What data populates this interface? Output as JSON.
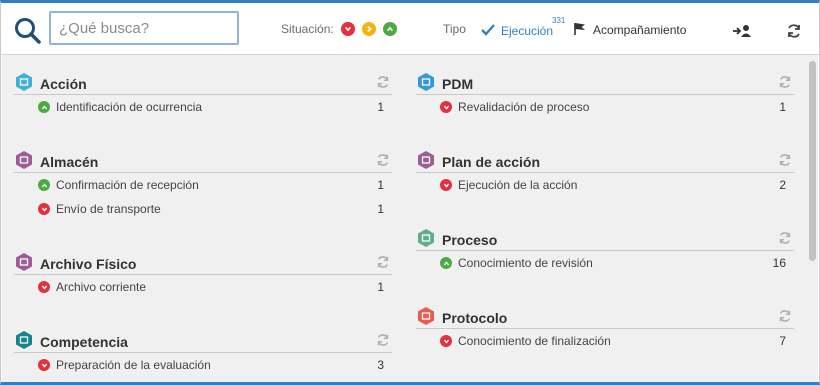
{
  "colors": {
    "accent": "#2f80c4",
    "red": "#e2323d",
    "yellow": "#f0b413",
    "green": "#4caa43",
    "gray_icon": "#9a9a9a"
  },
  "search": {
    "placeholder": "¿Qué busca?"
  },
  "toolbar": {
    "situacion_label": "Situación:",
    "tipo_label": "Tipo",
    "tabs": [
      {
        "label": "Ejecución",
        "count": "331",
        "icon": "check-icon",
        "active": true
      },
      {
        "label": "Acompañamiento",
        "icon": "flag-icon",
        "active": false
      }
    ]
  },
  "groups_left": [
    {
      "title": "Acción",
      "icon": "lightning-icon",
      "icon_color": "#3fb0d9",
      "items": [
        {
          "name": "Identificación de ocurrencia",
          "count": "1",
          "status": "green"
        }
      ]
    },
    {
      "title": "Almacén",
      "icon": "warehouse-icon",
      "icon_color": "#9b5d94",
      "items": [
        {
          "name": "Confirmación de recepción",
          "count": "1",
          "status": "green"
        },
        {
          "name": "Envío de transporte",
          "count": "1",
          "status": "red"
        }
      ]
    },
    {
      "title": "Archivo Físico",
      "icon": "archive-icon",
      "icon_color": "#9b5d94",
      "items": [
        {
          "name": "Archivo corriente",
          "count": "1",
          "status": "red"
        }
      ]
    },
    {
      "title": "Competencia",
      "icon": "competence-icon",
      "icon_color": "#14858a",
      "items": [
        {
          "name": "Preparación de la evaluación",
          "count": "3",
          "status": "red"
        }
      ]
    }
  ],
  "groups_right": [
    {
      "title": "PDM",
      "icon": "pdm-icon",
      "icon_color": "#3498d8",
      "items": [
        {
          "name": "Revalidación de proceso",
          "count": "1",
          "status": "red"
        }
      ]
    },
    {
      "title": "Plan de acción",
      "icon": "action-plan-icon",
      "icon_color": "#9b5d94",
      "items": [
        {
          "name": "Ejecución de la acción",
          "count": "2",
          "status": "red"
        }
      ]
    },
    {
      "title": "Proceso",
      "icon": "process-icon",
      "icon_color": "#5fae8b",
      "items": [
        {
          "name": "Conocimiento de revisión",
          "count": "16",
          "status": "green"
        }
      ]
    },
    {
      "title": "Protocolo",
      "icon": "protocol-icon",
      "icon_color": "#e85c4a",
      "items": [
        {
          "name": "Conocimiento de finalización",
          "count": "7",
          "status": "red"
        }
      ]
    }
  ]
}
